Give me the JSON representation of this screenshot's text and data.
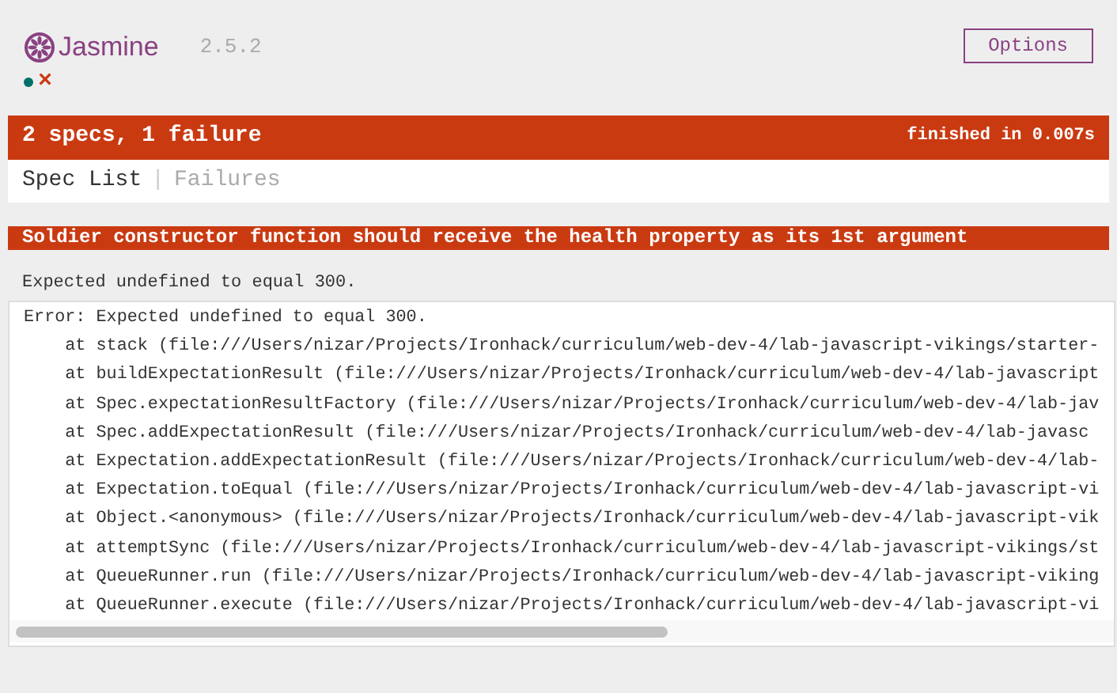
{
  "header": {
    "logo": "Jasmine",
    "version": "2.5.2",
    "options_button": "Options"
  },
  "spec_symbols": [
    {
      "kind": "passed"
    },
    {
      "kind": "failed",
      "glyph": "×"
    }
  ],
  "summary": {
    "text": "2 specs, 1 failure",
    "duration": "finished in 0.007s",
    "failed": true
  },
  "menu": [
    {
      "label": "Spec List",
      "selected": true
    },
    {
      "label": "Failures",
      "selected": false
    }
  ],
  "menu_separator": "|",
  "failure": {
    "title": "Soldier constructor function should receive the health property as its 1st argument",
    "message": "Expected undefined to equal 300.",
    "stack": [
      "Error: Expected undefined to equal 300.",
      "    at stack (file:///Users/nizar/Projects/Ironhack/curriculum/web-dev-4/lab-javascript-vikings/starter-",
      "    at buildExpectationResult (file:///Users/nizar/Projects/Ironhack/curriculum/web-dev-4/lab-javascript",
      "    at Spec.expectationResultFactory (file:///Users/nizar/Projects/Ironhack/curriculum/web-dev-4/lab-jav",
      "    at Spec.addExpectationResult (file:///Users/nizar/Projects/Ironhack/curriculum/web-dev-4/lab-javasc",
      "    at Expectation.addExpectationResult (file:///Users/nizar/Projects/Ironhack/curriculum/web-dev-4/lab-",
      "    at Expectation.toEqual (file:///Users/nizar/Projects/Ironhack/curriculum/web-dev-4/lab-javascript-vi",
      "    at Object.<anonymous> (file:///Users/nizar/Projects/Ironhack/curriculum/web-dev-4/lab-javascript-vik",
      "    at attemptSync (file:///Users/nizar/Projects/Ironhack/curriculum/web-dev-4/lab-javascript-vikings/st",
      "    at QueueRunner.run (file:///Users/nizar/Projects/Ironhack/curriculum/web-dev-4/lab-javascript-viking",
      "    at QueueRunner.execute (file:///Users/nizar/Projects/Ironhack/curriculum/web-dev-4/lab-javascript-vi"
    ]
  }
}
